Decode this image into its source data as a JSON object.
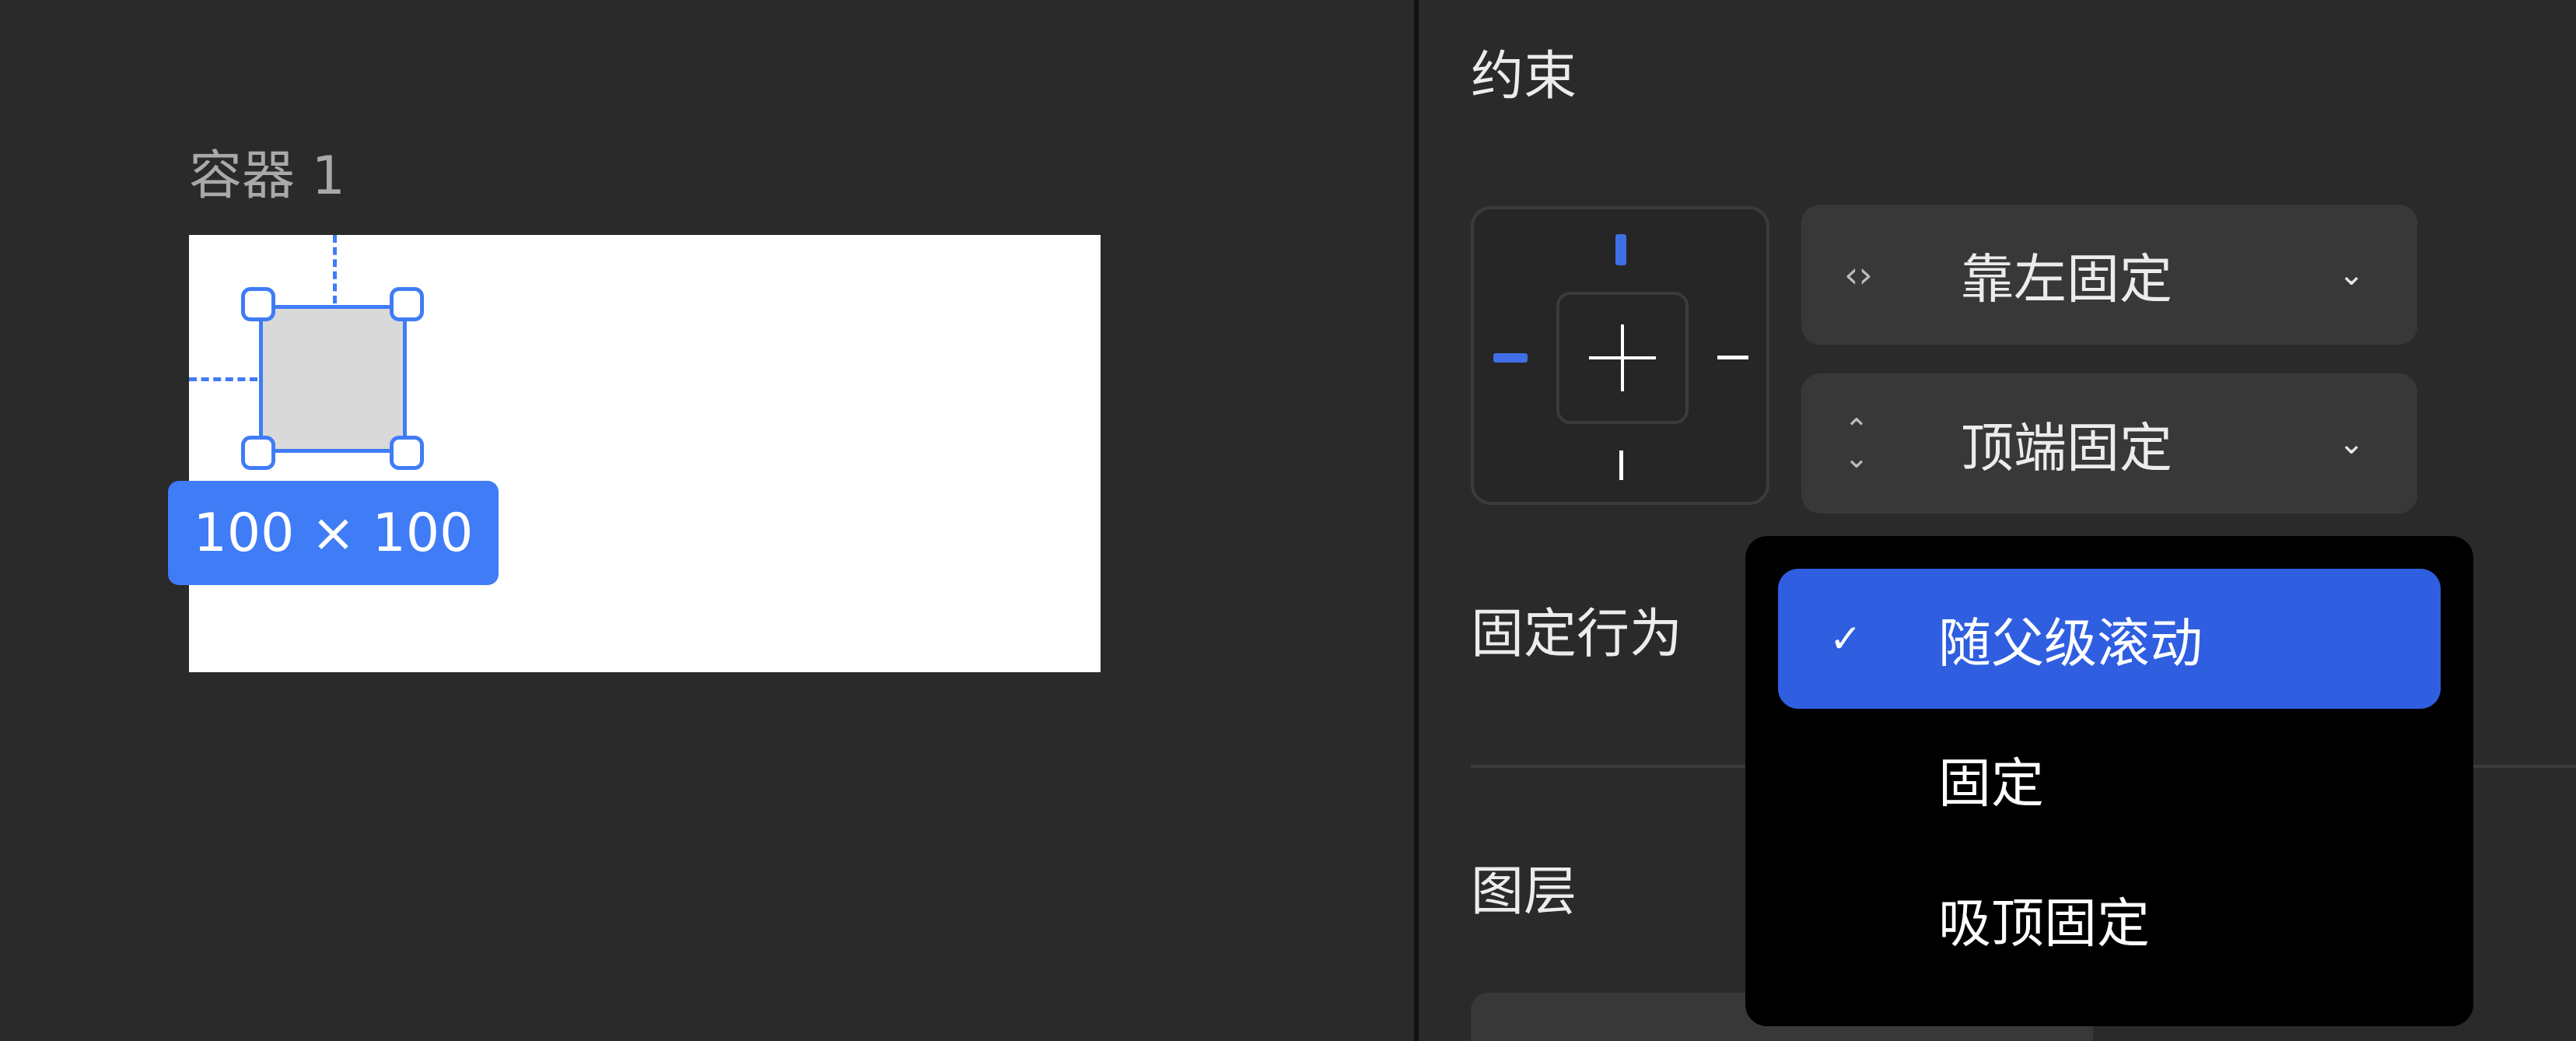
{
  "canvas": {
    "frame_label": "容器 1",
    "size_badge": "100 × 100",
    "selection_color": "#3f7cf6"
  },
  "panel": {
    "constraints_title": "约束",
    "horizontal_select": {
      "icon": "horizontal-arrows-icon",
      "value": "靠左固定"
    },
    "vertical_select": {
      "icon": "vertical-arrows-icon",
      "value": "顶端固定"
    },
    "fix_behavior_label": "固定行为",
    "layers_title": "图层",
    "accent_color": "#3f6fe6"
  },
  "dropdown": {
    "options": [
      {
        "label": "随父级滚动",
        "selected": true
      },
      {
        "label": "固定",
        "selected": false
      },
      {
        "label": "吸顶固定",
        "selected": false
      }
    ],
    "selected_bg": "#2f5fe0"
  }
}
